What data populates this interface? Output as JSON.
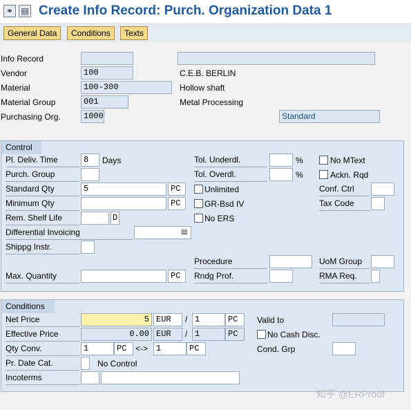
{
  "window": {
    "title": "Create Info Record: Purch. Organization Data 1"
  },
  "toolbar": {
    "icons": [
      "glasses-icon",
      "document-icon"
    ]
  },
  "tabs": [
    "General Data",
    "Conditions",
    "Texts"
  ],
  "header": {
    "info_record": {
      "label": "Info Record",
      "value": "",
      "desc": ""
    },
    "vendor": {
      "label": "Vendor",
      "value": "100",
      "desc": "C.E.B. BERLIN"
    },
    "material": {
      "label": "Material",
      "value": "100-300",
      "desc": "Hollow shaft"
    },
    "material_group": {
      "label": "Material Group",
      "value": "001",
      "desc": "Metal Processing"
    },
    "purchasing_org": {
      "label": "Purchasing Org.",
      "value": "1000",
      "desc": "Standard"
    }
  },
  "control": {
    "title": "Control",
    "pl_deliv_time": {
      "label": "Pl. Deliv. Time",
      "value": "8",
      "unit": "Days"
    },
    "purch_group": {
      "label": "Purch. Group",
      "value": ""
    },
    "standard_qty": {
      "label": "Standard Qty",
      "value": "5",
      "unit": "PC"
    },
    "minimum_qty": {
      "label": "Minimum Qty",
      "value": "",
      "unit": "PC"
    },
    "rem_shelf_life": {
      "label": "Rem. Shelf Life",
      "value": "",
      "unit": "D"
    },
    "differential_invoicing": {
      "label": "Differential Invoicing",
      "value": ""
    },
    "shipping_instr": {
      "label": "Shippg Instr.",
      "value": ""
    },
    "max_quantity": {
      "label": "Max. Quantity",
      "value": "",
      "unit": "PC"
    },
    "tol_underdl": {
      "label": "Tol. Underdl.",
      "value": "",
      "unit": "%"
    },
    "tol_overdl": {
      "label": "Tol. Overdl.",
      "value": "",
      "unit": "%"
    },
    "unlimited": {
      "label": "Unlimited",
      "checked": false
    },
    "gr_bsd_iv": {
      "label": "GR-Bsd IV",
      "checked": false
    },
    "no_ers": {
      "label": "No ERS",
      "checked": false
    },
    "procedure": {
      "label": "Procedure",
      "value": ""
    },
    "rndg_prof": {
      "label": "Rndg Prof.",
      "value": ""
    },
    "no_mtext": {
      "label": "No MText",
      "checked": false
    },
    "ackn_rqd": {
      "label": "Ackn. Rqd",
      "checked": false
    },
    "conf_ctrl": {
      "label": "Conf. Ctrl",
      "value": ""
    },
    "tax_code": {
      "label": "Tax Code",
      "value": ""
    },
    "uom_group": {
      "label": "UoM Group",
      "value": ""
    },
    "rma_req": {
      "label": "RMA Req.",
      "value": ""
    }
  },
  "conditions": {
    "title": "Conditions",
    "net_price": {
      "label": "Net Price",
      "value": "5",
      "currency": "EUR",
      "per": "1",
      "unit": "PC"
    },
    "effective_price": {
      "label": "Effective Price",
      "value": "0.00",
      "currency": "EUR",
      "per": "1",
      "unit": "PC"
    },
    "qty_conv": {
      "label": "Qty Conv.",
      "value1": "1",
      "unit1": "PC",
      "arrow": "<->",
      "value2": "1",
      "unit2": "PC"
    },
    "pr_date_cat": {
      "label": "Pr. Date Cat.",
      "value": "",
      "desc": "No Control"
    },
    "incoterms": {
      "label": "Incoterms",
      "value1": "",
      "value2": ""
    },
    "valid_to": {
      "label": "Valid to",
      "value": ""
    },
    "no_cash_disc": {
      "label": "No Cash Disc.",
      "checked": false
    },
    "cond_grp": {
      "label": "Cond. Grp",
      "value": ""
    },
    "slash": "/"
  },
  "watermark": "知乎 @ERProof"
}
